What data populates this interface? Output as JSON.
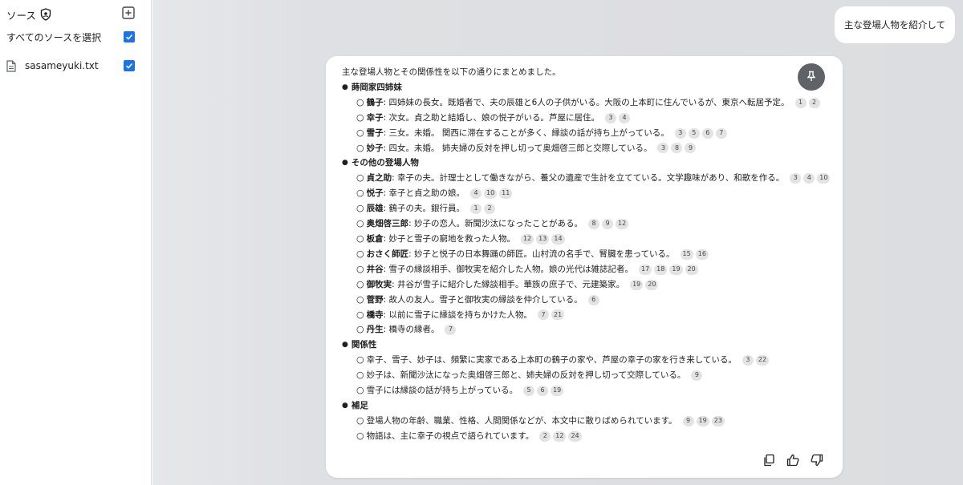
{
  "sidebar": {
    "title": "ソース",
    "select_all_label": "すべてのソースを選択",
    "sources": [
      {
        "name": "sasameyuki.txt",
        "checked": true
      }
    ]
  },
  "chat": {
    "user_message": "主な登場人物を紹介して",
    "answer": {
      "intro": "主な登場人物とその関係性を以下の通りにまとめました。",
      "sections": [
        {
          "heading": "蒔岡家四姉妹",
          "items": [
            {
              "name": "鶴子",
              "text": ": 四姉妹の長女。既婚者で、夫の辰雄と6人の子供がいる。大阪の上本町に住んでいるが、東京へ転居予定。",
              "cites": [
                "1",
                "2"
              ]
            },
            {
              "name": "幸子",
              "text": ": 次女。貞之助と結婚し、娘の悦子がいる。芦屋に居住。",
              "cites": [
                "3",
                "4"
              ]
            },
            {
              "name": "雪子",
              "text": ": 三女。未婚。 関西に滞在することが多く、縁談の話が持ち上がっている。",
              "cites": [
                "3",
                "5",
                "6",
                "7"
              ]
            },
            {
              "name": "妙子",
              "text": ": 四女。未婚。 姉夫婦の反対を押し切って奥畑啓三郎と交際している。",
              "cites": [
                "3",
                "8",
                "9"
              ]
            }
          ]
        },
        {
          "heading": "その他の登場人物",
          "items": [
            {
              "name": "貞之助",
              "text": ": 幸子の夫。計理士として働きながら、養父の遺産で生計を立てている。文学趣味があり、和歌を作る。",
              "cites": [
                "3",
                "4",
                "10"
              ]
            },
            {
              "name": "悦子",
              "text": ": 幸子と貞之助の娘。",
              "cites": [
                "4",
                "10",
                "11"
              ]
            },
            {
              "name": "辰雄",
              "text": ": 鶴子の夫。銀行員。",
              "cites": [
                "1",
                "2"
              ]
            },
            {
              "name": "奥畑啓三郎",
              "text": ": 妙子の恋人。新聞沙汰になったことがある。",
              "cites": [
                "8",
                "9",
                "12"
              ]
            },
            {
              "name": "板倉",
              "text": ": 妙子と雪子の窮地を救った人物。",
              "cites": [
                "12",
                "13",
                "14"
              ]
            },
            {
              "name": "おさく師匠",
              "text": ": 妙子と悦子の日本舞踊の師匠。山村流の名手で、腎臓を患っている。",
              "cites": [
                "15",
                "16"
              ]
            },
            {
              "name": "井谷",
              "text": ": 雪子の縁談相手、御牧実を紹介した人物。娘の光代は雑誌記者。",
              "cites": [
                "17",
                "18",
                "19",
                "20"
              ]
            },
            {
              "name": "御牧実",
              "text": ": 井谷が雪子に紹介した縁談相手。華族の庶子で、元建築家。",
              "cites": [
                "19",
                "20"
              ]
            },
            {
              "name": "菅野",
              "text": ": 故人の友人。雪子と御牧実の縁談を仲介している。",
              "cites": [
                "6"
              ]
            },
            {
              "name": "橋寺",
              "text": ": 以前に雪子に縁談を持ちかけた人物。",
              "cites": [
                "7",
                "21"
              ]
            },
            {
              "name": "丹生",
              "text": ": 橋寺の縁者。",
              "cites": [
                "7"
              ]
            }
          ]
        },
        {
          "heading": "関係性",
          "items": [
            {
              "name": "",
              "text": "幸子、雪子、妙子は、頻繁に実家である上本町の鶴子の家や、芦屋の幸子の家を行き来している。",
              "cites": [
                "3",
                "22"
              ]
            },
            {
              "name": "",
              "text": "妙子は、新聞沙汰になった奥畑啓三郎と、姉夫婦の反対を押し切って交際している。",
              "cites": [
                "9"
              ]
            },
            {
              "name": "",
              "text": "雪子には縁談の話が持ち上がっている。",
              "cites": [
                "5",
                "6",
                "19"
              ]
            }
          ]
        },
        {
          "heading": "補足",
          "items": [
            {
              "name": "",
              "text": "登場人物の年齢、職業、性格、人間関係などが、本文中に散りばめられています。",
              "cites": [
                "9",
                "19",
                "23"
              ]
            },
            {
              "name": "",
              "text": "物語は、主に幸子の視点で語られています。",
              "cites": [
                "2",
                "12",
                "24"
              ]
            }
          ]
        }
      ]
    }
  },
  "icons": {
    "shield": "shield-icon",
    "add": "add-box-icon",
    "document": "document-icon",
    "pin": "pin-icon",
    "copy": "copy-icon",
    "thumbs_up": "thumbs-up-icon",
    "thumbs_down": "thumbs-down-icon"
  },
  "colors": {
    "accent": "#1a73e8",
    "pin_button": "#5f6368",
    "citation_bg": "#e3e3e3"
  }
}
